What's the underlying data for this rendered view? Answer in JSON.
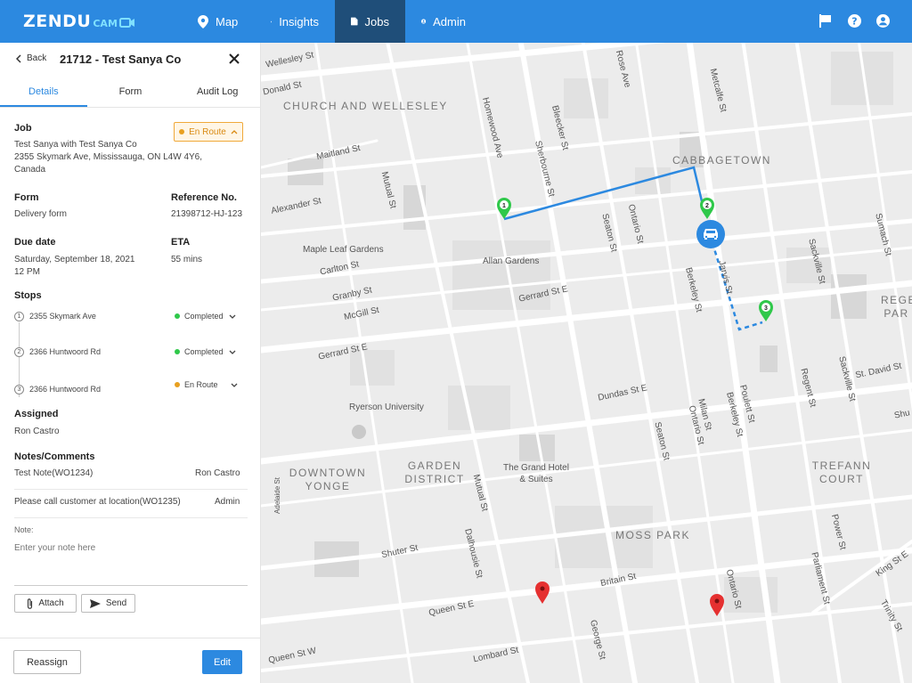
{
  "brand": {
    "name": "ZENDU",
    "suffix": "CAM"
  },
  "nav": {
    "items": [
      {
        "label": "Map",
        "icon": "map-pin-icon"
      },
      {
        "label": "Insights",
        "icon": "chart-icon"
      },
      {
        "label": "Jobs",
        "icon": "document-icon",
        "active": true
      },
      {
        "label": "Admin",
        "icon": "user-circle-icon"
      }
    ],
    "right_icons": [
      "flag-icon",
      "help-icon",
      "account-icon"
    ]
  },
  "panel": {
    "back_label": "Back",
    "title": "21712 - Test Sanya Co",
    "tabs": [
      {
        "label": "Details",
        "active": true
      },
      {
        "label": "Form"
      },
      {
        "label": "Audit Log"
      }
    ],
    "job": {
      "label": "Job",
      "status": "En Route",
      "line1": "Test Sanya with Test Sanya Co",
      "line2": "2355 Skymark Ave, Mississauga, ON L4W 4Y6,",
      "line3": "Canada"
    },
    "form": {
      "label": "Form",
      "value": "Delivery form"
    },
    "reference": {
      "label": "Reference No.",
      "value": "21398712-HJ-123"
    },
    "due": {
      "label": "Due date",
      "line1": "Saturday, September 18, 2021",
      "line2": "12 PM"
    },
    "eta": {
      "label": "ETA",
      "value": "55 mins"
    },
    "stops_label": "Stops",
    "stops": [
      {
        "num": "1",
        "address": "2355 Skymark Ave",
        "status": "Completed",
        "color": "#2fc84a"
      },
      {
        "num": "2",
        "address": "2366 Huntwoord Rd",
        "status": "Completed",
        "color": "#2fc84a"
      },
      {
        "num": "3",
        "address": "2366 Huntwoord Rd",
        "status": "En Route",
        "color": "#e8a020"
      }
    ],
    "assigned": {
      "label": "Assigned",
      "value": "Ron Castro"
    },
    "notes": {
      "label": "Notes/Comments",
      "items": [
        {
          "text": "Test Note(WO1234)",
          "author": "Ron Castro"
        },
        {
          "text": "Please call customer at location(WO1235)",
          "author": "Admin"
        }
      ]
    },
    "note_input": {
      "label": "Note:",
      "placeholder": "Enter your note here"
    },
    "attach_label": "Attach",
    "send_label": "Send",
    "reassign_label": "Reassign",
    "edit_label": "Edit"
  },
  "map": {
    "areas": [
      "CHURCH AND WELLESLEY",
      "CABBAGETOWN",
      "DOWNTOWN YONGE",
      "GARDEN DISTRICT",
      "TREFANN COURT",
      "MOSS PARK",
      "REGE PAR"
    ],
    "places": [
      "Maple Leaf Gardens",
      "Allan Gardens",
      "Ryerson University",
      "The Grand Hotel & Suites"
    ],
    "streets": [
      "Wellesley St",
      "Donald St",
      "Maitland St",
      "Alexander St",
      "Carlton St",
      "Granby St",
      "McGill St",
      "Gerrard St E",
      "Dundas St E",
      "Shuter St",
      "Queen St E",
      "Queen St W",
      "Lombard St",
      "Homewood Ave",
      "Sherbourne St",
      "Bleecker St",
      "Rose Ave",
      "Metcalfe St",
      "Jarvis St",
      "Seaton St",
      "Ontario St",
      "Berkeley St",
      "Sackville St",
      "Sumach St",
      "St. David St",
      "Regent St",
      "Milan St",
      "Poulett St",
      "Power St",
      "Parliament St",
      "King St E",
      "Trinity St",
      "Britain St",
      "George St",
      "Dalhousie St",
      "Mutual St",
      "Shu",
      "Adelaide St"
    ],
    "route_color": "#2c89e0",
    "pin_green": "#2fc84a",
    "pin_red": "#e53030"
  },
  "colors": {
    "nav_bg": "#2c89e0",
    "nav_active": "#1f4e79",
    "accent": "#2c89e0",
    "en_route": "#e8a020",
    "completed": "#2fc84a"
  }
}
